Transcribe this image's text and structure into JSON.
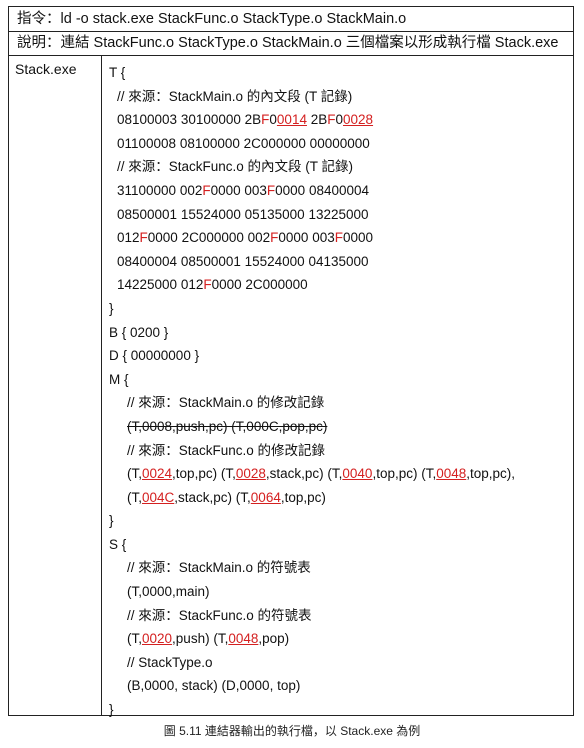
{
  "header": {
    "command": "指令：ld -o stack.exe StackFunc.o StackType.o StackMain.o",
    "description": "說明：連結  StackFunc.o StackType.o StackMain.o  三個檔案以形成執行檔  Stack.exe"
  },
  "file_label": "Stack.exe",
  "lines": [
    {
      "indent": 0,
      "parts": [
        {
          "t": "T {"
        }
      ]
    },
    {
      "indent": 1,
      "parts": [
        {
          "t": "// 來源：StackMain.o  的內文段  (T  記錄)"
        }
      ]
    },
    {
      "indent": 1,
      "parts": [
        {
          "t": "08100003 30100000 2B"
        },
        {
          "t": "F",
          "c": "r"
        },
        {
          "t": "0"
        },
        {
          "t": "0014",
          "c": "u"
        },
        {
          "t": " 2B"
        },
        {
          "t": "F",
          "c": "r"
        },
        {
          "t": "0"
        },
        {
          "t": "0028",
          "c": "u"
        }
      ]
    },
    {
      "indent": 1,
      "parts": [
        {
          "t": "01100008 08100000 2C000000 00000000"
        }
      ]
    },
    {
      "indent": 1,
      "parts": [
        {
          "t": "// 來源：StackFunc.o 的內文段  (T  記錄)"
        }
      ]
    },
    {
      "indent": 1,
      "parts": [
        {
          "t": "31100000 002"
        },
        {
          "t": "F",
          "c": "r"
        },
        {
          "t": "0000 003"
        },
        {
          "t": "F",
          "c": "r"
        },
        {
          "t": "0000 08400004"
        }
      ]
    },
    {
      "indent": 1,
      "parts": [
        {
          "t": "08500001 15524000 05135000 13225000"
        }
      ]
    },
    {
      "indent": 1,
      "parts": [
        {
          "t": "012"
        },
        {
          "t": "F",
          "c": "r"
        },
        {
          "t": "0000 2C000000 002"
        },
        {
          "t": "F",
          "c": "r"
        },
        {
          "t": "0000 003"
        },
        {
          "t": "F",
          "c": "r"
        },
        {
          "t": "0000"
        }
      ]
    },
    {
      "indent": 1,
      "parts": [
        {
          "t": "08400004 08500001 15524000 04135000"
        }
      ]
    },
    {
      "indent": 1,
      "parts": [
        {
          "t": "14225000 012"
        },
        {
          "t": "F",
          "c": "r"
        },
        {
          "t": "0000 2C000000"
        }
      ]
    },
    {
      "indent": 0,
      "parts": [
        {
          "t": "}"
        }
      ]
    },
    {
      "indent": 0,
      "parts": [
        {
          "t": "B { 0200 }"
        }
      ]
    },
    {
      "indent": 0,
      "parts": [
        {
          "t": "D { 00000000 }"
        }
      ]
    },
    {
      "indent": 0,
      "parts": [
        {
          "t": "M {"
        }
      ]
    },
    {
      "indent": 2,
      "parts": [
        {
          "t": "// 來源：StackMain.o 的修改記錄"
        }
      ]
    },
    {
      "indent": 2,
      "parts": [
        {
          "t": "(T,0008,push,pc)  (T,000C,pop,pc)",
          "c": "strike"
        }
      ]
    },
    {
      "indent": 2,
      "parts": [
        {
          "t": "// 來源：StackFunc.o 的修改記錄"
        }
      ]
    },
    {
      "indent": 2,
      "parts": [
        {
          "t": "(T,"
        },
        {
          "t": "0024",
          "c": "u"
        },
        {
          "t": ",top,pc) (T,"
        },
        {
          "t": "0028",
          "c": "u"
        },
        {
          "t": ",stack,pc) (T,"
        },
        {
          "t": "0040",
          "c": "u"
        },
        {
          "t": ",top,pc) (T,"
        },
        {
          "t": "0048",
          "c": "u"
        },
        {
          "t": ",top,pc),"
        }
      ]
    },
    {
      "indent": 2,
      "parts": [
        {
          "t": "(T,"
        },
        {
          "t": "004C",
          "c": "u"
        },
        {
          "t": ",stack,pc) (T,"
        },
        {
          "t": "0064",
          "c": "u"
        },
        {
          "t": ",top,pc)"
        }
      ]
    },
    {
      "indent": 0,
      "parts": [
        {
          "t": "}"
        }
      ]
    },
    {
      "indent": 0,
      "parts": [
        {
          "t": "S {"
        }
      ]
    },
    {
      "indent": 2,
      "parts": [
        {
          "t": "// 來源：StackMain.o 的符號表"
        }
      ]
    },
    {
      "indent": 2,
      "parts": [
        {
          "t": "(T,0000,main)"
        }
      ]
    },
    {
      "indent": 2,
      "parts": [
        {
          "t": "// 來源：StackFunc.o 的符號表"
        }
      ]
    },
    {
      "indent": 2,
      "parts": [
        {
          "t": "(T,"
        },
        {
          "t": "0020",
          "c": "u"
        },
        {
          "t": ",push) (T,"
        },
        {
          "t": "0048",
          "c": "u"
        },
        {
          "t": ",pop)"
        }
      ]
    },
    {
      "indent": 2,
      "parts": [
        {
          "t": "// StackType.o"
        }
      ]
    },
    {
      "indent": 2,
      "parts": [
        {
          "t": "(B,0000, stack) (D,0000, top)"
        }
      ]
    },
    {
      "indent": 0,
      "parts": [
        {
          "t": "}"
        }
      ]
    }
  ],
  "caption": "圖  5.11 連結器輸出的執行檔，以   Stack.exe  為例",
  "colors": {
    "highlight": "#d42020",
    "border": "#222222"
  }
}
